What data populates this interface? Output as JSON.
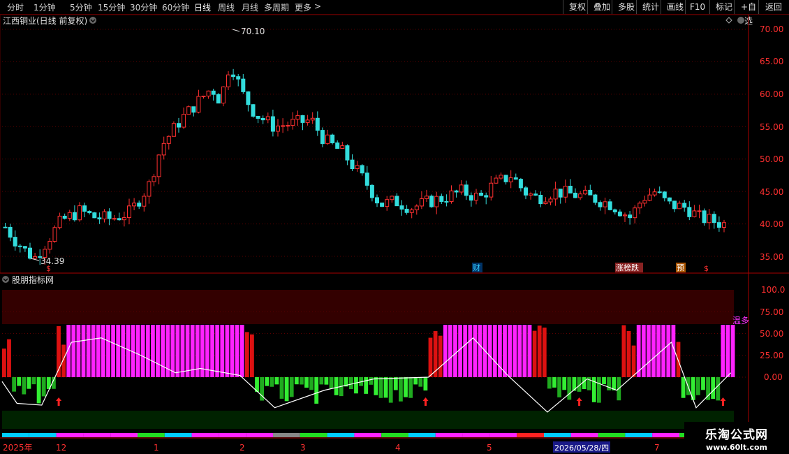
{
  "toolbar": {
    "periods": [
      "分时",
      "1分钟",
      "5分钟",
      "15分钟",
      "30分钟",
      "60分钟",
      "日线",
      "周线",
      "月线",
      "多周期",
      "更多"
    ],
    "more_arrow": ">",
    "active_index": 6,
    "buttons": [
      "复权",
      "叠加",
      "多股",
      "统计",
      "画线",
      "F10",
      "标记",
      "+自选",
      "返回"
    ]
  },
  "main_panel": {
    "title": "江西铜业(日线 前复权)",
    "y_ticks": [
      "70.00",
      "65.00",
      "60.00",
      "55.00",
      "50.00",
      "45.00",
      "40.00",
      "35.00"
    ],
    "high_label": "70.10",
    "low_label": "34.39",
    "markers": [
      {
        "text": "$",
        "color": "#ff3030"
      },
      {
        "text": "财",
        "color": "#33ccff"
      },
      {
        "text": "涨榜跌",
        "color": "#ffffff"
      },
      {
        "text": "预",
        "color": "#ffffff"
      },
      {
        "text": "$",
        "color": "#ff3030"
      }
    ]
  },
  "indicator_panel": {
    "title": "股朋指标网",
    "y_ticks": [
      "100.0",
      "75.00",
      "50.00",
      "25.00",
      "0.00"
    ],
    "side_label": "温多"
  },
  "timeline": {
    "labels": [
      "2025年",
      "12",
      "1",
      "2",
      "3",
      "4",
      "5",
      "2026/05/28/四",
      "7"
    ]
  },
  "watermark": {
    "line1": "乐淘公式网",
    "line2": "www.60lt.com"
  },
  "chart_data": {
    "type": "candlestick",
    "title": "江西铜业(日线 前复权)",
    "ylim": [
      33,
      71.5
    ],
    "y_ticks": [
      70,
      65,
      60,
      55,
      50,
      45,
      40,
      35
    ],
    "price_range": {
      "high": 70.1,
      "low": 34.39
    },
    "indicator_ylim": [
      0,
      100
    ],
    "indicator_ticks": [
      100,
      75,
      50,
      25,
      0
    ],
    "colors": {
      "up": "#ff3030",
      "down": "#33dddd",
      "magenta": "#ff22ff",
      "green": "#22dd22",
      "red": "#dd1111"
    }
  }
}
